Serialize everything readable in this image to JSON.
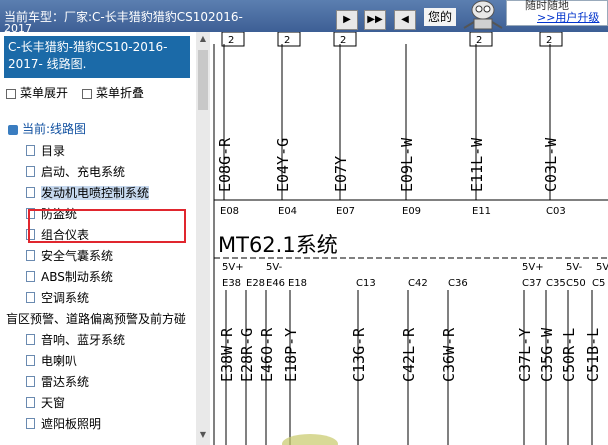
{
  "topbar": {
    "label": "当前车型：厂家:C-长丰猎豹猎豹CS102016-",
    "label_cont": "2017",
    "nav_buttons": [
      "▶",
      "▶▶",
      "◀"
    ],
    "greeting": "您的",
    "upgrade_line1": "随时随地",
    "upgrade_link": ">>用户升级"
  },
  "left": {
    "doc_title": "C-长丰猎豹-猎豹CS10-2016-2017- 线路图.",
    "expand_label": "菜单展开",
    "collapse_label": "菜单折叠",
    "tree_root": "当前:线路图",
    "items": [
      "目录",
      "启动、充电系统",
      "发动机电喷控制系统",
      "防盗统",
      "组合仪表",
      "安全气囊系统",
      "ABS制动系统",
      "空调系统"
    ],
    "group": "盲区预警、道路偏离预警及前方碰",
    "group_items": [
      "音响、蓝牙系统",
      "电喇叭",
      "雷达系统",
      "天窗",
      "遮阳板照明"
    ],
    "selected_index": 2
  },
  "diagram": {
    "top_connectors": [
      "2",
      "2",
      "2",
      "2",
      "2"
    ],
    "upper_wires": [
      {
        "label": "E08G-R",
        "pin": "E08"
      },
      {
        "label": "E04Y-G",
        "pin": "E04"
      },
      {
        "label": "E07Y",
        "pin": "E07"
      },
      {
        "label": "E09L-W",
        "pin": "E09"
      },
      {
        "label": "E11L-W",
        "pin": "E11"
      },
      {
        "label": "C03L-W",
        "pin": "C03"
      }
    ],
    "system_title": "MT62.1系统",
    "power_labels": [
      "5V+",
      "5V-",
      "5V+",
      "5V-",
      "5V"
    ],
    "pin_labels": [
      "E38",
      "E28",
      "E46",
      "E18",
      "C13",
      "C42",
      "C36",
      "C37",
      "C35",
      "C50",
      "C5"
    ],
    "lower_wires": [
      "E38W-R",
      "E28R-G",
      "E46O-R",
      "E18P-Y",
      "C13G-R",
      "C42L-R",
      "C36W-R",
      "C37L-Y",
      "C35G-W",
      "C50R-L",
      "C51B-L"
    ]
  }
}
